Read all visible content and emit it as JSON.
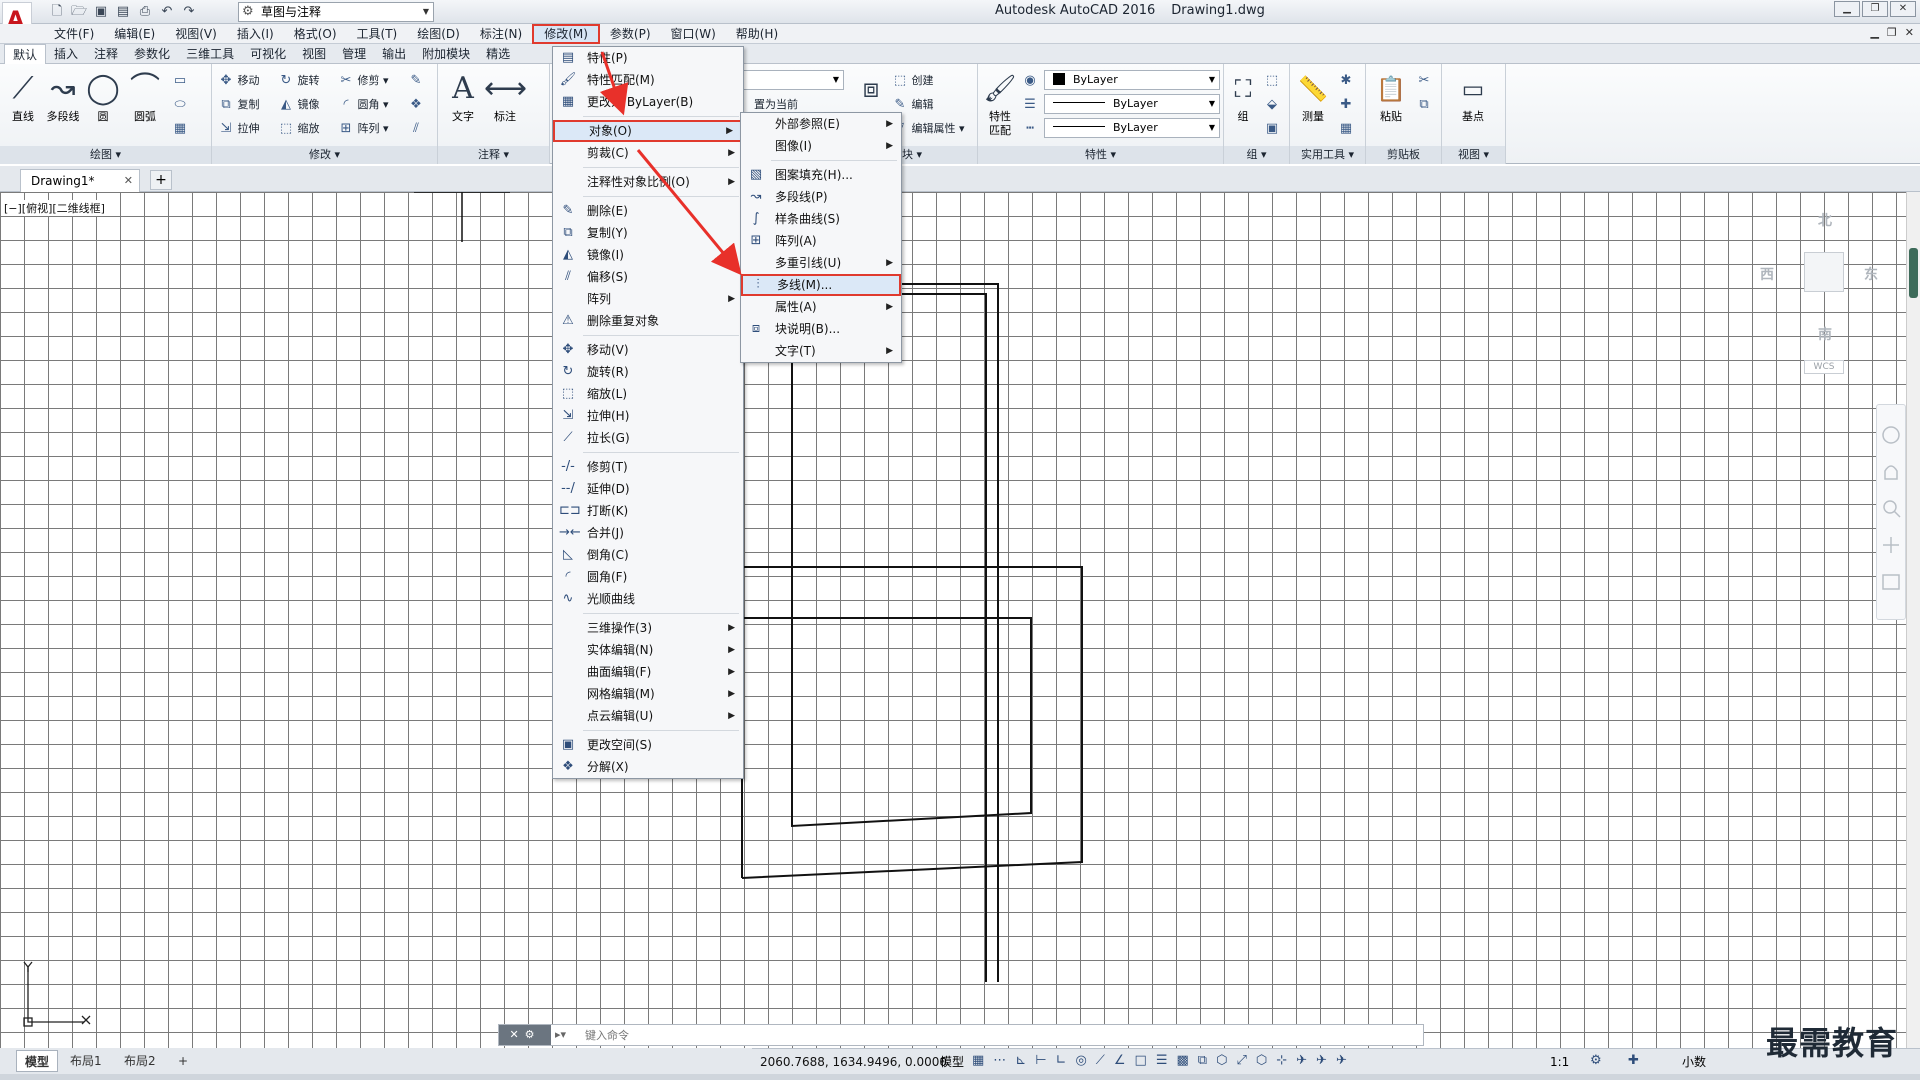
{
  "window": {
    "app_name": "Autodesk AutoCAD 2016",
    "file_name": "Drawing1.dwg",
    "workspace": "草图与注释"
  },
  "menubar": {
    "items": [
      "文件(F)",
      "编辑(E)",
      "视图(V)",
      "插入(I)",
      "格式(O)",
      "工具(T)",
      "绘图(D)",
      "标注(N)",
      "修改(M)",
      "参数(P)",
      "窗口(W)",
      "帮助(H)"
    ],
    "active": "修改(M)"
  },
  "ribbon": {
    "tabs": [
      "默认",
      "插入",
      "注释",
      "参数化",
      "三维工具",
      "可视化",
      "视图",
      "管理",
      "输出",
      "附加模块",
      "精选"
    ],
    "active_tab": "默认",
    "draw": {
      "title": "绘图",
      "line": "直线",
      "polyline": "多段线",
      "circle": "圆",
      "arc": "圆弧"
    },
    "modify": {
      "title": "修改",
      "move": "移动",
      "rotate": "旋转",
      "trim": "修剪",
      "copy": "复制",
      "mirror": "镜像",
      "fillet": "圆角",
      "stretch": "拉伸",
      "scale": "缩放",
      "array": "阵列"
    },
    "annotation": {
      "title": "注释",
      "text": "文字",
      "dimension": "标注"
    },
    "layers": {
      "set_current": "置为当前"
    },
    "block": {
      "title": "块",
      "create": "创建",
      "edit": "编辑",
      "edit_attributes": "编辑属性"
    },
    "properties": {
      "title": "特性",
      "match": "特性匹配",
      "color": "ByLayer",
      "linetype": "ByLayer",
      "lineweight": "ByLayer"
    },
    "groups": {
      "title": "组",
      "group": "组"
    },
    "utilities": {
      "title": "实用工具",
      "measure": "测量"
    },
    "clipboard": {
      "title": "剪贴板",
      "paste": "粘贴"
    },
    "view": {
      "title": "视图",
      "base": "基点"
    }
  },
  "filetab": {
    "name": "Drawing1*"
  },
  "viewport_label": "[−][俯视][二维线框]",
  "viewcube": {
    "north": "北",
    "south": "南",
    "east": "东",
    "west": "西",
    "wcs": "WCS"
  },
  "modify_menu": [
    {
      "label": "特性(P)",
      "icon": "properties-icon"
    },
    {
      "label": "特性匹配(M)",
      "icon": "match-icon"
    },
    {
      "label": "更改为 ByLayer(B)",
      "icon": "bylayer-icon"
    },
    {
      "sep": true
    },
    {
      "label": "对象(O)",
      "icon": "",
      "sub": true,
      "highlight": true
    },
    {
      "label": "剪裁(C)",
      "icon": "",
      "sub": true
    },
    {
      "sep": true
    },
    {
      "label": "注释性对象比例(O)",
      "icon": "",
      "sub": true
    },
    {
      "sep": true
    },
    {
      "label": "删除(E)",
      "icon": "erase-icon"
    },
    {
      "label": "复制(Y)",
      "icon": "copy-icon"
    },
    {
      "label": "镜像(I)",
      "icon": "mirror-icon"
    },
    {
      "label": "偏移(S)",
      "icon": "offset-icon"
    },
    {
      "label": "阵列",
      "icon": "",
      "sub": true
    },
    {
      "label": "删除重复对象",
      "icon": "overkill-icon"
    },
    {
      "sep": true
    },
    {
      "label": "移动(V)",
      "icon": "move-icon"
    },
    {
      "label": "旋转(R)",
      "icon": "rotate-icon"
    },
    {
      "label": "缩放(L)",
      "icon": "scale-icon"
    },
    {
      "label": "拉伸(H)",
      "icon": "stretch-icon"
    },
    {
      "label": "拉长(G)",
      "icon": "lengthen-icon"
    },
    {
      "sep": true
    },
    {
      "label": "修剪(T)",
      "icon": "trim-icon"
    },
    {
      "label": "延伸(D)",
      "icon": "extend-icon"
    },
    {
      "label": "打断(K)",
      "icon": "break-icon"
    },
    {
      "label": "合并(J)",
      "icon": "join-icon"
    },
    {
      "label": "倒角(C)",
      "icon": "chamfer-icon"
    },
    {
      "label": "圆角(F)",
      "icon": "fillet-icon"
    },
    {
      "label": "光顺曲线",
      "icon": "blend-icon"
    },
    {
      "sep": true
    },
    {
      "label": "三维操作(3)",
      "icon": "",
      "sub": true
    },
    {
      "label": "实体编辑(N)",
      "icon": "",
      "sub": true
    },
    {
      "label": "曲面编辑(F)",
      "icon": "",
      "sub": true
    },
    {
      "label": "网格编辑(M)",
      "icon": "",
      "sub": true
    },
    {
      "label": "点云编辑(U)",
      "icon": "",
      "sub": true
    },
    {
      "sep": true
    },
    {
      "label": "更改空间(S)",
      "icon": "chspace-icon"
    },
    {
      "label": "分解(X)",
      "icon": "explode-icon"
    }
  ],
  "object_submenu": [
    {
      "label": "外部参照(E)",
      "icon": "",
      "sub": true
    },
    {
      "label": "图像(I)",
      "icon": "",
      "sub": true
    },
    {
      "sep": true
    },
    {
      "label": "图案填充(H)...",
      "icon": "hatch-icon"
    },
    {
      "label": "多段线(P)",
      "icon": "pedit-icon"
    },
    {
      "label": "样条曲线(S)",
      "icon": "spline-icon"
    },
    {
      "label": "阵列(A)",
      "icon": "array-icon"
    },
    {
      "label": "多重引线(U)",
      "icon": "",
      "sub": true
    },
    {
      "label": "多线(M)...",
      "icon": "mline-icon",
      "highlight": true
    },
    {
      "label": "属性(A)",
      "icon": "",
      "sub": true
    },
    {
      "label": "块说明(B)...",
      "icon": "block-desc-icon"
    },
    {
      "label": "文字(T)",
      "icon": "",
      "sub": true
    }
  ],
  "cmdline": {
    "placeholder": "键入命令"
  },
  "status": {
    "layout_tabs": [
      "模型",
      "布局1",
      "布局2"
    ],
    "coords": "2060.7688, 1634.9496, 0.0000",
    "model": "模型",
    "scale": "1:1",
    "units": "小数"
  },
  "watermark": "最需教育",
  "colors": {
    "highlight_border": "#e03a2e",
    "arrow": "#e8302a",
    "logo_red": "#c8161d"
  }
}
